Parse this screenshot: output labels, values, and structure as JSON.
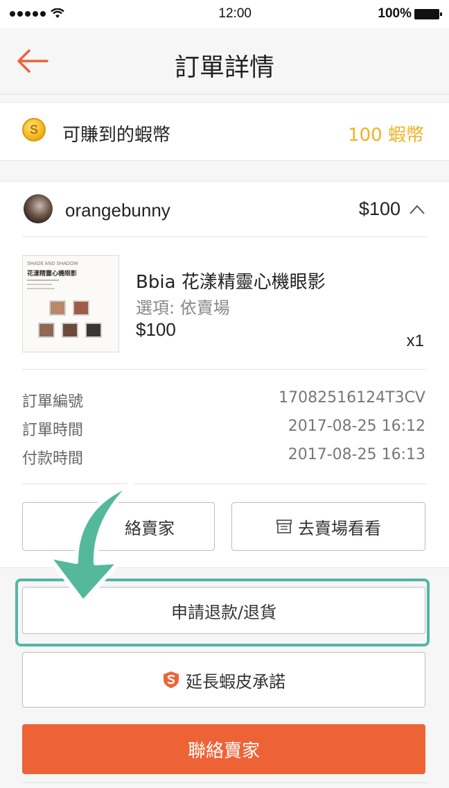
{
  "status_bar": {
    "time": "12:00",
    "battery": "100%"
  },
  "nav": {
    "title": "訂單詳情"
  },
  "coins": {
    "label": "可賺到的蝦幣",
    "value": "100 蝦幣",
    "icon_letter": "S"
  },
  "shop": {
    "name": "orangebunny",
    "total": "$100"
  },
  "product": {
    "name": "Bbia 花漾精靈心機眼影",
    "option": "選項: 依賣場",
    "price": "$100",
    "qty": "x1",
    "thumb_text_1": "SHADE AND SHADOW",
    "thumb_text_2": "花漾精靈心機眼影"
  },
  "order_info": [
    {
      "label": "訂單編號",
      "value": "17082516124T3CV"
    },
    {
      "label": "訂單時間",
      "value": "2017-08-25 16:12"
    },
    {
      "label": "付款時間",
      "value": "2017-08-25 16:13"
    }
  ],
  "actions": {
    "contact_seller_partial": "絡賣家",
    "visit_shop": "去賣場看看",
    "refund": "申請退款/退貨",
    "extend_guarantee": "延長蝦皮承諾",
    "contact_seller": "聯絡賣家"
  },
  "colors": {
    "accent": "#ee6336",
    "coin": "#f0b224",
    "highlight": "#54b6a4",
    "back_arrow": "#ee6336"
  },
  "icons": {
    "back": "left-arrow-icon",
    "coin": "coin-icon",
    "chevron": "chevron-up-icon",
    "shop": "storefront-icon",
    "guarantee": "shield-s-icon",
    "pointer": "curved-arrow-icon"
  }
}
